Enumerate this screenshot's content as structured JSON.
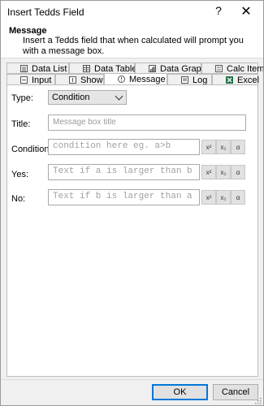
{
  "window": {
    "title": "Insert Tedds Field",
    "help_glyph": "?",
    "close_glyph": "✕"
  },
  "header": {
    "title": "Message",
    "description": "Insert a Tedds field that when calculated will prompt you with a message box."
  },
  "tabs_top": [
    {
      "label": "Data List",
      "icon": "list-icon"
    },
    {
      "label": "Data Table",
      "icon": "table-icon"
    },
    {
      "label": "Data Graph",
      "icon": "graph-icon"
    },
    {
      "label": "Calc Item",
      "icon": "calc-icon"
    }
  ],
  "tabs_bottom": [
    {
      "label": "Input",
      "icon": "input-icon"
    },
    {
      "label": "Show",
      "icon": "show-icon"
    },
    {
      "label": "Message",
      "icon": "message-icon",
      "active": true
    },
    {
      "label": "Log",
      "icon": "log-icon"
    },
    {
      "label": "Excel",
      "icon": "excel-icon"
    }
  ],
  "form": {
    "type_label": "Type:",
    "type_value": "Condition",
    "title_label": "Title:",
    "title_placeholder": "Message box title",
    "condition_label": "Condition:",
    "condition_placeholder": "condition here eg. a>b",
    "yes_label": "Yes:",
    "yes_placeholder": "Text if a is larger than b",
    "no_label": "No:",
    "no_placeholder": "Text if b is larger than a",
    "format_buttons": [
      "x²",
      "x₂",
      "α"
    ]
  },
  "footer": {
    "ok_label": "OK",
    "cancel_label": "Cancel"
  },
  "colors": {
    "accent": "#0078d7",
    "excel_green": "#1e7145"
  }
}
